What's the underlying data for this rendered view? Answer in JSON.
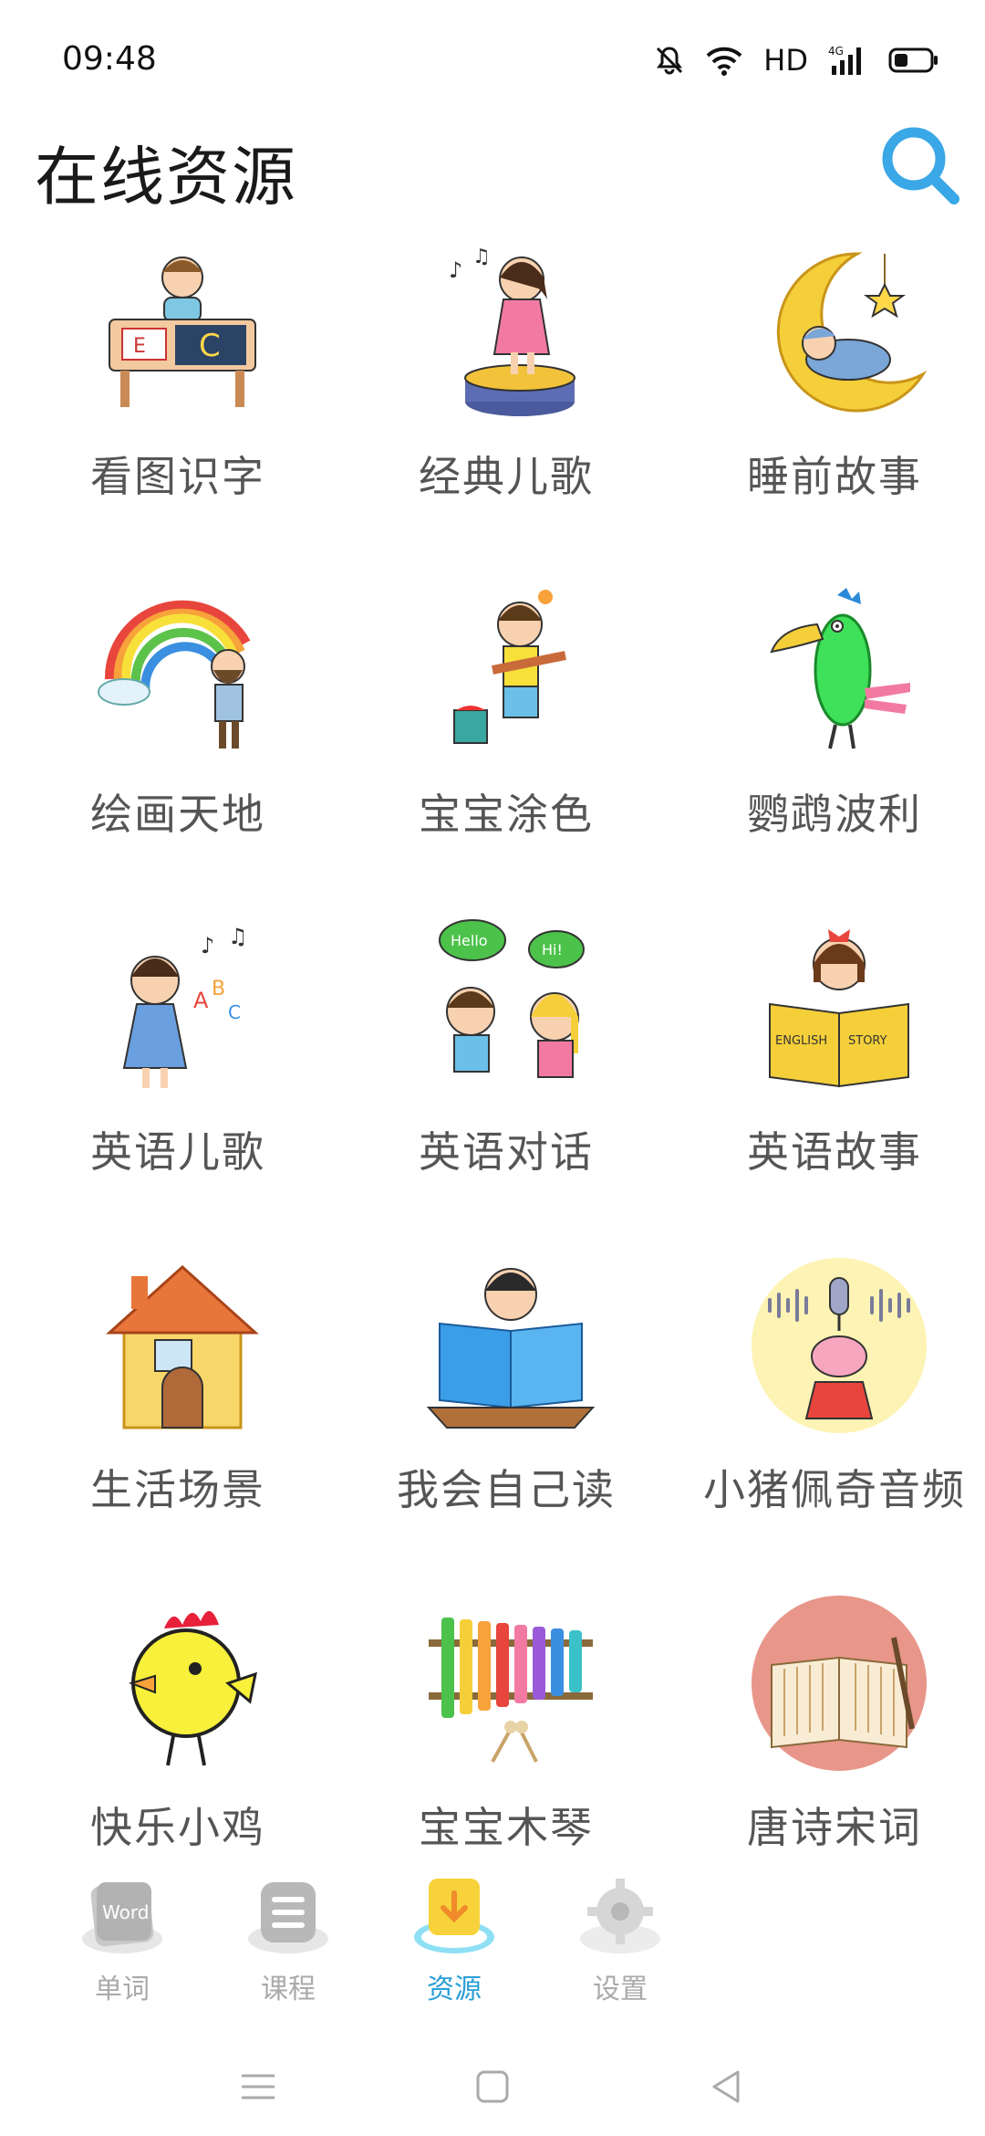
{
  "status_bar": {
    "time": "09:48",
    "network_label": "HD",
    "network_type": "4G"
  },
  "header": {
    "title": "在线资源",
    "search_icon": "search-icon"
  },
  "resources": [
    {
      "label": "看图识字",
      "icon": "child-studying-letters"
    },
    {
      "label": "经典儿歌",
      "icon": "girl-singing-on-stage"
    },
    {
      "label": "睡前故事",
      "icon": "baby-sleeping-on-moon"
    },
    {
      "label": "绘画天地",
      "icon": "painter-drawing-rainbow"
    },
    {
      "label": "宝宝涂色",
      "icon": "girl-with-paintbrush"
    },
    {
      "label": "鹦鹉波利",
      "icon": "parrot"
    },
    {
      "label": "英语儿歌",
      "icon": "girl-singing-abc"
    },
    {
      "label": "英语对话",
      "icon": "kids-saying-hello"
    },
    {
      "label": "英语故事",
      "icon": "girl-reading-english-story"
    },
    {
      "label": "生活场景",
      "icon": "house"
    },
    {
      "label": "我会自己读",
      "icon": "boy-reading-book"
    },
    {
      "label": "小猪佩奇音频",
      "icon": "peppa-pig-microphone"
    },
    {
      "label": "快乐小鸡",
      "icon": "yellow-chick"
    },
    {
      "label": "宝宝木琴",
      "icon": "xylophone"
    },
    {
      "label": "唐诗宋词",
      "icon": "ancient-book-with-brush"
    }
  ],
  "tabbar": {
    "tabs": [
      {
        "label": "单词",
        "icon": "word-card-icon",
        "active": false
      },
      {
        "label": "课程",
        "icon": "course-list-icon",
        "active": false
      },
      {
        "label": "资源",
        "icon": "download-resource-icon",
        "active": true
      },
      {
        "label": "设置",
        "icon": "settings-gear-icon",
        "active": false
      }
    ],
    "word_icon_text": "Word"
  },
  "colors": {
    "accent": "#2a9fd6",
    "search": "#3aa7e6",
    "tab_inactive": "#aaaaaa",
    "label": "#555555"
  }
}
